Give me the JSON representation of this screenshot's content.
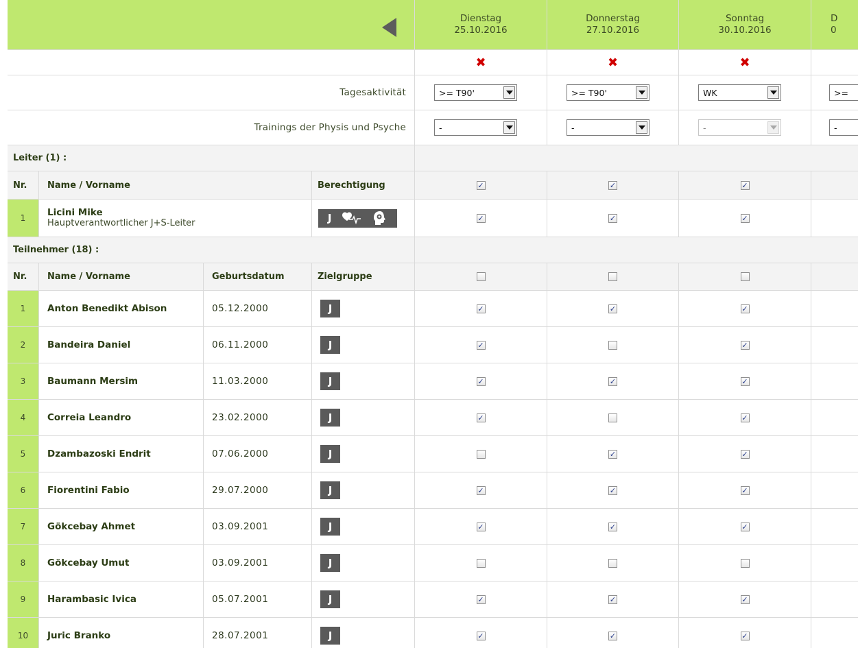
{
  "dates": [
    {
      "weekday": "Dienstag",
      "date": "25.10.2016"
    },
    {
      "weekday": "Donnerstag",
      "date": "27.10.2016"
    },
    {
      "weekday": "Sonntag",
      "date": "30.10.2016"
    },
    {
      "weekday": "D",
      "date": "0"
    }
  ],
  "delete_mark": "✖",
  "tagesaktivitaet": {
    "label": "Tagesaktivität",
    "values": [
      ">= T90'",
      ">= T90'",
      "WK",
      ">="
    ]
  },
  "trainings": {
    "label": "Trainings der Physis und Psyche",
    "values": [
      "-",
      "-",
      "-",
      "-"
    ]
  },
  "leiter": {
    "section_title": "Leiter (1) :",
    "col_nr": "Nr.",
    "col_name": "Name / Vorname",
    "col_perm": "Berechtigung",
    "header_checks": [
      true,
      true,
      true
    ],
    "rows": [
      {
        "nr": "1",
        "name": "Licini Mike",
        "role": "Hauptverantwortlicher J+S-Leiter",
        "badge": "J",
        "checks": [
          true,
          true,
          true
        ]
      }
    ]
  },
  "teilnehmer": {
    "section_title": "Teilnehmer (18) :",
    "col_nr": "Nr.",
    "col_name": "Name / Vorname",
    "col_birth": "Geburtsdatum",
    "col_group": "Zielgruppe",
    "header_checks": [
      false,
      false,
      false
    ],
    "rows": [
      {
        "nr": "1",
        "name": "Anton Benedikt Abison",
        "birth": "05.12.2000",
        "badge": "J",
        "checks": [
          true,
          true,
          true
        ]
      },
      {
        "nr": "2",
        "name": "Bandeira Daniel",
        "birth": "06.11.2000",
        "badge": "J",
        "checks": [
          true,
          false,
          true
        ]
      },
      {
        "nr": "3",
        "name": "Baumann Mersim",
        "birth": "11.03.2000",
        "badge": "J",
        "checks": [
          true,
          true,
          true
        ]
      },
      {
        "nr": "4",
        "name": "Correia Leandro",
        "birth": "23.02.2000",
        "badge": "J",
        "checks": [
          true,
          false,
          true
        ]
      },
      {
        "nr": "5",
        "name": "Dzambazoski Endrit",
        "birth": "07.06.2000",
        "badge": "J",
        "checks": [
          false,
          true,
          true
        ]
      },
      {
        "nr": "6",
        "name": "Fiorentini Fabio",
        "birth": "29.07.2000",
        "badge": "J",
        "checks": [
          true,
          true,
          true
        ]
      },
      {
        "nr": "7",
        "name": "Gökcebay Ahmet",
        "birth": "03.09.2001",
        "badge": "J",
        "checks": [
          true,
          true,
          true
        ]
      },
      {
        "nr": "8",
        "name": "Gökcebay Umut",
        "birth": "03.09.2001",
        "badge": "J",
        "checks": [
          false,
          false,
          false
        ]
      },
      {
        "nr": "9",
        "name": "Harambasic Ivica",
        "birth": "05.07.2001",
        "badge": "J",
        "checks": [
          true,
          true,
          true
        ]
      },
      {
        "nr": "10",
        "name": "Juric Branko",
        "birth": "28.07.2001",
        "badge": "J",
        "checks": [
          true,
          true,
          true
        ]
      }
    ]
  },
  "colors": {
    "header_green": "#bfe86f",
    "badge_gray": "#5a5a5a",
    "delete_red": "#d00000"
  }
}
